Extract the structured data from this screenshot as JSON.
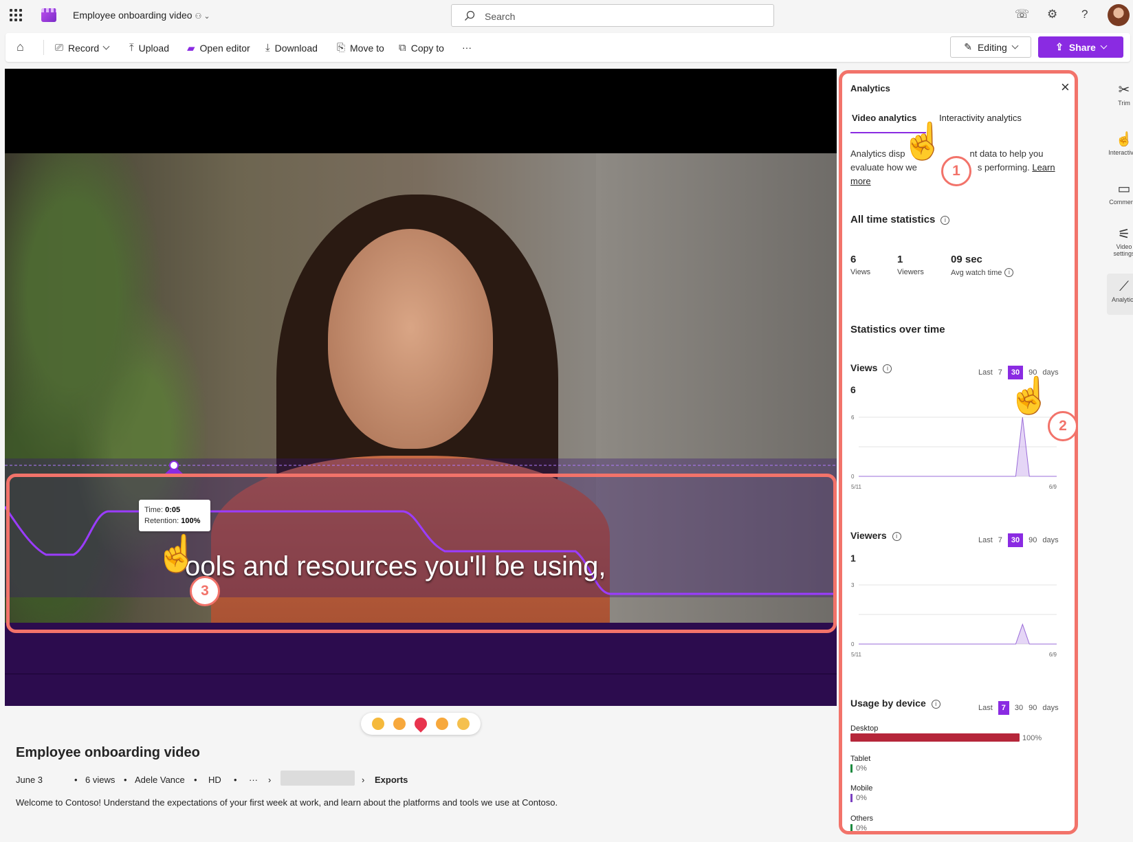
{
  "topbar": {
    "doc_title": "Employee onboarding video",
    "search_placeholder": "Search"
  },
  "commands": {
    "record": "Record",
    "upload": "Upload",
    "open_editor": "Open editor",
    "download": "Download",
    "move_to": "Move to",
    "copy_to": "Copy to",
    "more": "···",
    "editing": "Editing",
    "share": "Share"
  },
  "video": {
    "caption": "ools and resources you'll be using,",
    "tooltip_time_label": "Time:",
    "tooltip_time": "0:05",
    "tooltip_retention_label": "Retention:",
    "tooltip_retention": "100%",
    "retention_curve": {
      "description_source": "retention overlay",
      "points_percent": [
        100,
        75,
        100,
        100,
        50,
        20,
        20
      ]
    }
  },
  "details": {
    "title": "Employee onboarding video",
    "date": "June 3",
    "views": "6 views",
    "author": "Adele Vance",
    "quality": "HD",
    "more": "···",
    "breadcrumb_last": "Exports",
    "description": "Welcome to Contoso! Understand the expectations of your first week at work, and learn about the platforms and tools we use at Contoso."
  },
  "analytics": {
    "title": "Analytics",
    "tabs": [
      "Video analytics",
      "Interactivity analytics"
    ],
    "desc_part1": "Analytics disp",
    "desc_part2": "nt data to help you",
    "desc_part3": "evaluate how we",
    "desc_part4": "s performing.",
    "learn_more": "Learn more",
    "all_time_heading": "All time statistics",
    "stats": [
      {
        "value": "6",
        "label": "Views"
      },
      {
        "value": "1",
        "label": "Viewers"
      },
      {
        "value": "09 sec",
        "label": "Avg watch time"
      }
    ],
    "over_time_heading": "Statistics over time",
    "range_last": "Last",
    "range_days": "days",
    "range_options": [
      "7",
      "30",
      "90"
    ],
    "views_section": {
      "label": "Views",
      "total": "6",
      "selected_range": "30"
    },
    "viewers_section": {
      "label": "Viewers",
      "total": "1",
      "selected_range": "30"
    },
    "usage_section": {
      "label": "Usage by device",
      "selected_range": "7"
    },
    "devices": [
      {
        "name": "Desktop",
        "pct": "100%",
        "value": 100
      },
      {
        "name": "Tablet",
        "pct": "0%",
        "value": 0
      },
      {
        "name": "Mobile",
        "pct": "0%",
        "value": 0
      },
      {
        "name": "Others",
        "pct": "0%",
        "value": 0
      }
    ]
  },
  "chart_data": [
    {
      "type": "area",
      "series": [
        {
          "values": [
            0,
            0,
            0,
            0,
            0,
            0,
            0,
            0,
            0,
            0,
            0,
            0,
            0,
            0,
            0,
            0,
            0,
            0,
            0,
            0,
            0,
            0,
            0,
            0,
            6,
            0,
            0,
            0,
            0,
            0
          ]
        }
      ],
      "x_start_label": "5/11",
      "x_end_label": "6/9",
      "ylim": [
        0,
        6
      ],
      "y_ticks": [
        "0",
        "6"
      ]
    },
    {
      "type": "area",
      "series": [
        {
          "values": [
            0,
            0,
            0,
            0,
            0,
            0,
            0,
            0,
            0,
            0,
            0,
            0,
            0,
            0,
            0,
            0,
            0,
            0,
            0,
            0,
            0,
            0,
            0,
            0,
            1,
            0,
            0,
            0,
            0,
            0
          ]
        }
      ],
      "x_start_label": "5/11",
      "x_end_label": "6/9",
      "ylim": [
        0,
        3
      ],
      "y_ticks": [
        "0",
        "3"
      ]
    }
  ],
  "rail": [
    "Trim",
    "Interactivity",
    "Comments",
    "Video settings",
    "Analytics"
  ],
  "annotations": [
    "1",
    "2",
    "3"
  ],
  "colors": {
    "accent": "#8a2be2",
    "highlight": "#f2736a",
    "desktop_bar": "#b5263a"
  }
}
